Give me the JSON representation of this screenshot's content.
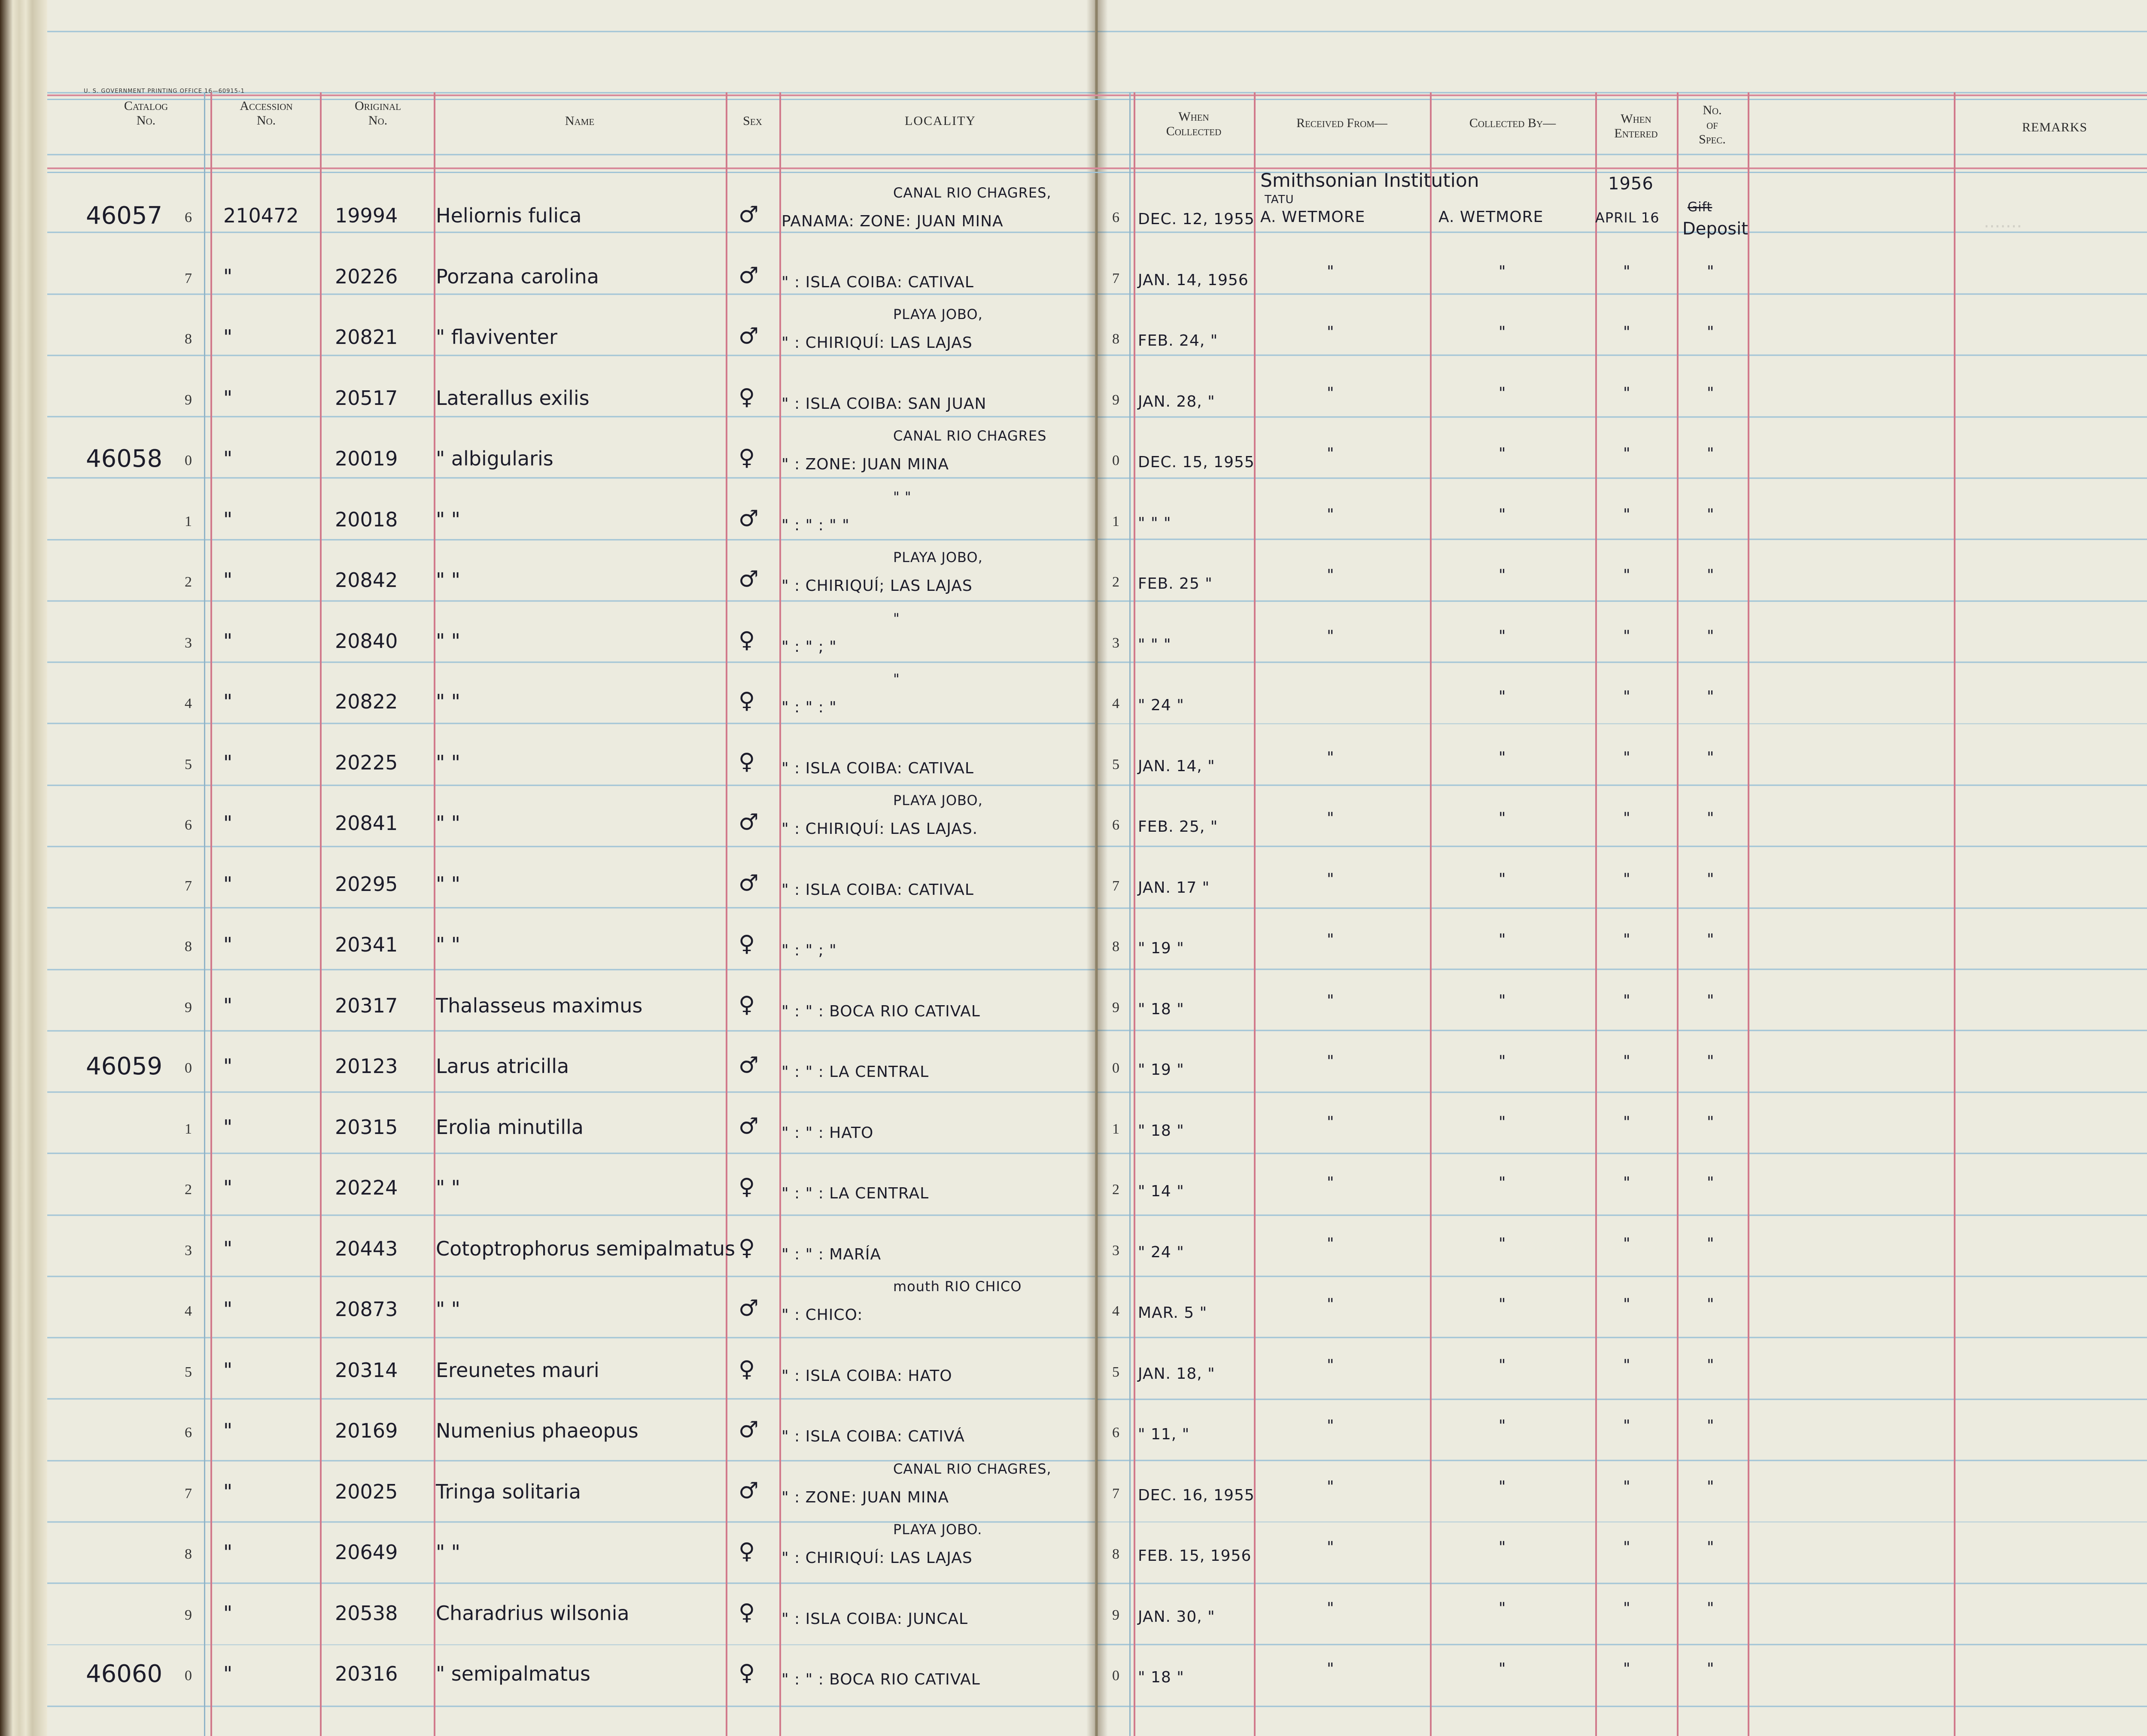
{
  "printer_note": "U. S. GOVERNMENT PRINTING OFFICE    16—60915-1",
  "headers": {
    "catalog": [
      "Catalog",
      "No."
    ],
    "accession": [
      "Accession",
      "No."
    ],
    "original": [
      "Original",
      "No."
    ],
    "name": "Name",
    "sex": "Sex",
    "locality": "LOCALITY",
    "when_collected": [
      "When",
      "Collected"
    ],
    "received_from": "Received From—",
    "collected_by": "Collected By—",
    "when_entered": [
      "When",
      "Entered"
    ],
    "no_of_spec": [
      "No.",
      "of",
      "Spec."
    ],
    "remarks": "REMARKS"
  },
  "first_entry": {
    "received_line1": "Smithsonian Institution",
    "received_tatu": "TATU",
    "received_line2": "A. WETMORE",
    "collected": "A. WETMORE",
    "entered_year": "1956",
    "entered_date": "APRIL 16",
    "spec_struck": "Gift",
    "spec": "Deposit"
  },
  "rows": [
    {
      "cat": "46057",
      "d": "6",
      "acc": "210472",
      "orig": "19994",
      "name": "Heliornis fulica",
      "sex": "♂",
      "loc_top": "CANAL   RIO CHAGRES,",
      "loc": "PANAMA: ZONE: JUAN MINA",
      "date": "DEC. 12, 1955",
      "rf": "",
      "cb": "",
      "we": "",
      "ns": ""
    },
    {
      "cat": "",
      "d": "7",
      "acc": "\"",
      "orig": "20226",
      "name": "Porzana carolina",
      "sex": "♂",
      "loc_top": "",
      "loc": "\" : ISLA COIBA: CATIVAL",
      "date": "JAN. 14, 1956",
      "rf": "\"",
      "cb": "\"",
      "we": "\"",
      "ns": "\""
    },
    {
      "cat": "",
      "d": "8",
      "acc": "\"",
      "orig": "20821",
      "name": "\"  flaviventer",
      "sex": "♂",
      "loc_top": "PLAYA JOBO,",
      "loc": "\" : CHIRIQUÍ: LAS LAJAS",
      "date": "FEB. 24, \"",
      "rf": "\"",
      "cb": "\"",
      "we": "\"",
      "ns": "\""
    },
    {
      "cat": "",
      "d": "9",
      "acc": "\"",
      "orig": "20517",
      "name": "Laterallus exilis",
      "sex": "♀",
      "loc_top": "",
      "loc": "\" : ISLA COIBA: SAN JUAN",
      "date": "JAN. 28, \"",
      "rf": "\"",
      "cb": "\"",
      "we": "\"",
      "ns": "\""
    },
    {
      "cat": "46058",
      "d": "0",
      "acc": "\"",
      "orig": "20019",
      "name": "\"  albigularis",
      "sex": "♀",
      "loc_top": "CANAL   RIO CHAGRES",
      "loc": "\" : ZONE: JUAN MINA",
      "date": "DEC. 15, 1955",
      "rf": "\"",
      "cb": "\"",
      "we": "\"",
      "ns": "\""
    },
    {
      "cat": "",
      "d": "1",
      "acc": "\"",
      "orig": "20018",
      "name": "\"      \"",
      "sex": "♂",
      "loc_top": "\"  \"",
      "loc": "\" :  \"  :  \"  \"",
      "date": "\"  \"  \"",
      "rf": "\"",
      "cb": "\"",
      "we": "\"",
      "ns": "\""
    },
    {
      "cat": "",
      "d": "2",
      "acc": "\"",
      "orig": "20842",
      "name": "\"      \"",
      "sex": "♂",
      "loc_top": "PLAYA JOBO,",
      "loc": "\" : CHIRIQUÍ; LAS LAJAS",
      "date": "FEB. 25  \"",
      "rf": "\"",
      "cb": "\"",
      "we": "\"",
      "ns": "\""
    },
    {
      "cat": "",
      "d": "3",
      "acc": "\"",
      "orig": "20840",
      "name": "\"      \"",
      "sex": "♀",
      "loc_top": "\"",
      "loc": "\" :  \" ;  \"",
      "date": "\"  \"  \"",
      "rf": "\"",
      "cb": "\"",
      "we": "\"",
      "ns": "\""
    },
    {
      "cat": "",
      "d": "4",
      "acc": "\"",
      "orig": "20822",
      "name": "\"      \"",
      "sex": "♀",
      "loc_top": "\"",
      "loc": "\" :  \" :  \"",
      "date": "\" 24 \"",
      "rf": "",
      "cb": "\"",
      "we": "\"",
      "ns": "\""
    },
    {
      "cat": "",
      "d": "5",
      "acc": "\"",
      "orig": "20225",
      "name": "\"      \"",
      "sex": "♀",
      "loc_top": "",
      "loc": "\" : ISLA COIBA: CATIVAL",
      "date": "JAN. 14, \"",
      "rf": "\"",
      "cb": "\"",
      "we": "\"",
      "ns": "\""
    },
    {
      "cat": "",
      "d": "6",
      "acc": "\"",
      "orig": "20841",
      "name": "\"      \"",
      "sex": "♂",
      "loc_top": "PLAYA JOBO,",
      "loc": "\" : CHIRIQUÍ: LAS LAJAS.",
      "date": "FEB. 25, \"",
      "rf": "\"",
      "cb": "\"",
      "we": "\"",
      "ns": "\""
    },
    {
      "cat": "",
      "d": "7",
      "acc": "\"",
      "orig": "20295",
      "name": "\"      \"",
      "sex": "♂",
      "loc_top": "",
      "loc": "\" : ISLA COIBA: CATIVAL",
      "date": "JAN. 17  \"",
      "rf": "\"",
      "cb": "\"",
      "we": "\"",
      "ns": "\""
    },
    {
      "cat": "",
      "d": "8",
      "acc": "\"",
      "orig": "20341",
      "name": "\"      \"",
      "sex": "♀",
      "loc_top": "",
      "loc": "\" :  \" ;  \"",
      "date": "\" 19 \"",
      "rf": "\"",
      "cb": "\"",
      "we": "\"",
      "ns": "\""
    },
    {
      "cat": "",
      "d": "9",
      "acc": "\"",
      "orig": "20317",
      "name": "Thalasseus maximus",
      "sex": "♀",
      "loc_top": "",
      "loc": "\" :  \" : BOCA RIO CATIVAL",
      "date": "\" 18 \"",
      "rf": "\"",
      "cb": "\"",
      "we": "\"",
      "ns": "\""
    },
    {
      "cat": "46059",
      "d": "0",
      "acc": "\"",
      "orig": "20123",
      "name": "Larus atricilla",
      "sex": "♂",
      "loc_top": "",
      "loc": "\" :  \" : LA CENTRAL",
      "date": "\" 19 \"",
      "rf": "\"",
      "cb": "\"",
      "we": "\"",
      "ns": "\""
    },
    {
      "cat": "",
      "d": "1",
      "acc": "\"",
      "orig": "20315",
      "name": "Erolia minutilla",
      "sex": "♂",
      "loc_top": "",
      "loc": "\" :  \" : HATO",
      "date": "\" 18 \"",
      "rf": "\"",
      "cb": "\"",
      "we": "\"",
      "ns": "\""
    },
    {
      "cat": "",
      "d": "2",
      "acc": "\"",
      "orig": "20224",
      "name": "\"      \"",
      "sex": "♀",
      "loc_top": "",
      "loc": "\" :  \" : LA CENTRAL",
      "date": "\" 14 \"",
      "rf": "\"",
      "cb": "\"",
      "we": "\"",
      "ns": "\""
    },
    {
      "cat": "",
      "d": "3",
      "acc": "\"",
      "orig": "20443",
      "name": "Cotoptrophorus semipalmatus",
      "sex": "♀",
      "loc_top": "",
      "loc": "\" :  \" : MARÍA",
      "date": "\" 24 \"",
      "rf": "\"",
      "cb": "\"",
      "we": "\"",
      "ns": "\""
    },
    {
      "cat": "",
      "d": "4",
      "acc": "\"",
      "orig": "20873",
      "name": "\"      \"",
      "sex": "♂",
      "loc_top": "mouth RIO CHICO",
      "loc": "\" : CHICO:",
      "date": "MAR. 5 \"",
      "rf": "\"",
      "cb": "\"",
      "we": "\"",
      "ns": "\""
    },
    {
      "cat": "",
      "d": "5",
      "acc": "\"",
      "orig": "20314",
      "name": "Ereunetes mauri",
      "sex": "♀",
      "loc_top": "",
      "loc": "\" : ISLA COIBA: HATO",
      "date": "JAN. 18, \"",
      "rf": "\"",
      "cb": "\"",
      "we": "\"",
      "ns": "\""
    },
    {
      "cat": "",
      "d": "6",
      "acc": "\"",
      "orig": "20169",
      "name": "Numenius phaeopus",
      "sex": "♂",
      "loc_top": "",
      "loc": "\" : ISLA COIBA: CATIVÁ",
      "date": "\" 11, \"",
      "rf": "\"",
      "cb": "\"",
      "we": "\"",
      "ns": "\""
    },
    {
      "cat": "",
      "d": "7",
      "acc": "\"",
      "orig": "20025",
      "name": "Tringa solitaria",
      "sex": "♂",
      "loc_top": "CANAL   RIO CHAGRES,",
      "loc": "\" : ZONE: JUAN MINA",
      "date": "DEC. 16, 1955",
      "rf": "\"",
      "cb": "\"",
      "we": "\"",
      "ns": "\""
    },
    {
      "cat": "",
      "d": "8",
      "acc": "\"",
      "orig": "20649",
      "name": "\"      \"",
      "sex": "♀",
      "loc_top": "PLAYA JOBO.",
      "loc": "\" : CHIRIQUÍ: LAS LAJAS",
      "date": "FEB. 15, 1956",
      "rf": "\"",
      "cb": "\"",
      "we": "\"",
      "ns": "\""
    },
    {
      "cat": "",
      "d": "9",
      "acc": "\"",
      "orig": "20538",
      "name": "Charadrius wilsonia",
      "sex": "♀",
      "loc_top": "",
      "loc": "\" : ISLA COIBA: JUNCAL",
      "date": "JAN. 30, \"",
      "rf": "\"",
      "cb": "\"",
      "we": "\"",
      "ns": "\""
    },
    {
      "cat": "46060",
      "d": "0",
      "acc": "\"",
      "orig": "20316",
      "name": "\"  semipalmatus",
      "sex": "♀",
      "loc_top": "",
      "loc": "\" :  \" : BOCA RIO CATIVAL",
      "date": "\" 18 \"",
      "rf": "\"",
      "cb": "\"",
      "we": "\"",
      "ns": "\""
    }
  ]
}
